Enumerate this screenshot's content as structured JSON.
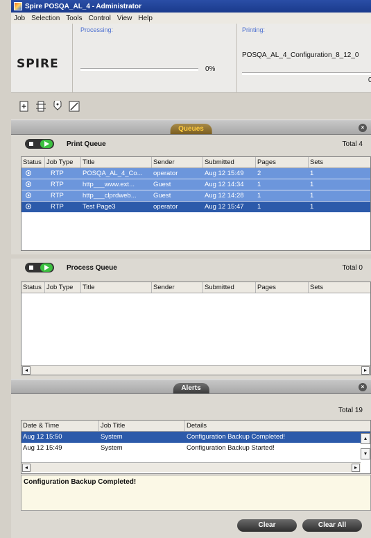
{
  "window": {
    "title": "Spire POSQA_AL_4 - Administrator"
  },
  "menu": [
    "Job",
    "Selection",
    "Tools",
    "Control",
    "View",
    "Help"
  ],
  "status": {
    "logo": "SPIRE",
    "processing_label": "Processing:",
    "processing_percent": "0%",
    "printing_label": "Printing:",
    "printing_job": "POSQA_AL_4_Configuration_8_12_0",
    "printing_percent": "0"
  },
  "toolbar": {
    "icons": [
      "import-job-icon",
      "job-center-icon",
      "resource-center-icon",
      "archive-icon"
    ]
  },
  "queues": {
    "tab_label": "Queues",
    "print_queue": {
      "title": "Print Queue",
      "total": "Total 4",
      "columns": [
        "Status",
        "Job Type",
        "Title",
        "Sender",
        "Submitted",
        "Pages",
        "Sets"
      ],
      "rows": [
        {
          "type": "RTP",
          "title": "POSQA_AL_4_Co...",
          "sender": "operator",
          "submitted": "Aug 12 15:49",
          "pages": "2",
          "sets": "1"
        },
        {
          "type": "RTP",
          "title": "http___www.ext...",
          "sender": "Guest",
          "submitted": "Aug 12 14:34",
          "pages": "1",
          "sets": "1"
        },
        {
          "type": "RTP",
          "title": "http___clprdweb...",
          "sender": "Guest",
          "submitted": "Aug 12 14:28",
          "pages": "1",
          "sets": "1"
        },
        {
          "type": "RTP",
          "title": "Test Page3",
          "sender": "operator",
          "submitted": "Aug 12 15:47",
          "pages": "1",
          "sets": "1"
        }
      ]
    },
    "process_queue": {
      "title": "Process Queue",
      "total": "Total 0",
      "columns": [
        "Status",
        "Job Type",
        "Title",
        "Sender",
        "Submitted",
        "Pages",
        "Sets"
      ]
    }
  },
  "alerts": {
    "tab_label": "Alerts",
    "total": "Total 19",
    "columns": [
      "Date & Time",
      "Job Title",
      "Details"
    ],
    "rows": [
      {
        "time": "Aug 12 15:50",
        "job": "System",
        "details": "Configuration Backup Completed!"
      },
      {
        "time": "Aug 12 15:49",
        "job": "System",
        "details": "Configuration Backup Started!"
      }
    ],
    "detail_text": "Configuration Backup Completed!",
    "clear_label": "Clear",
    "clear_all_label": "Clear All"
  }
}
